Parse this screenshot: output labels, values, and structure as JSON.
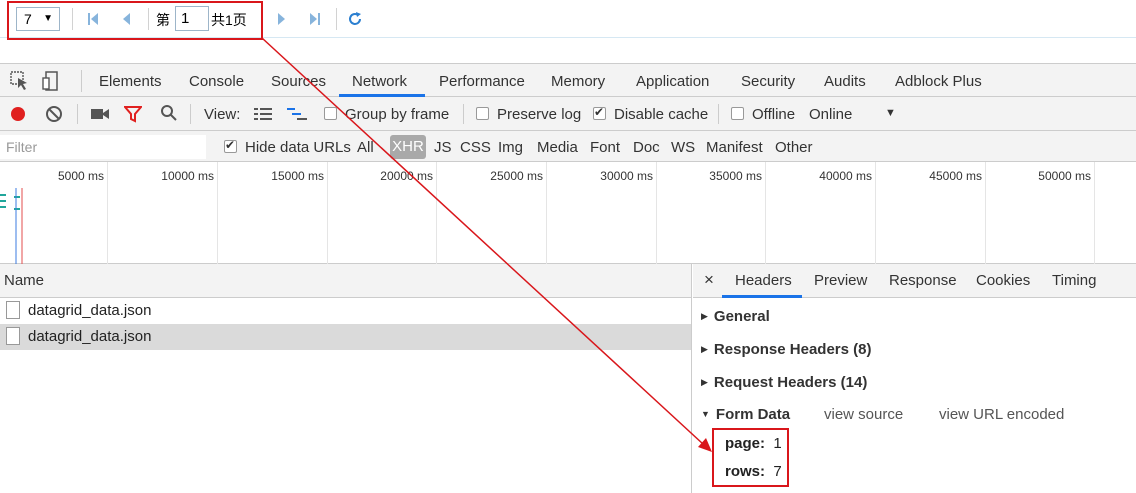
{
  "pager": {
    "page_size": "7",
    "page_prefix": "第",
    "page_value": "1",
    "page_total": "共1页"
  },
  "devtools": {
    "tabs": [
      "Elements",
      "Console",
      "Sources",
      "Network",
      "Performance",
      "Memory",
      "Application",
      "Security",
      "Audits",
      "Adblock Plus"
    ],
    "active_tab": "Network",
    "accent": "#1a73e8",
    "toolbar": {
      "view_label": "View:",
      "group_by_frame": "Group by frame",
      "preserve_log": "Preserve log",
      "disable_cache": "Disable cache",
      "offline": "Offline",
      "throttle": "Online"
    },
    "filter": {
      "placeholder": "Filter",
      "hide_data_urls": "Hide data URLs",
      "types": [
        "All",
        "XHR",
        "JS",
        "CSS",
        "Img",
        "Media",
        "Font",
        "Doc",
        "WS",
        "Manifest",
        "Other"
      ],
      "active_type": "XHR"
    },
    "timeline_ticks": [
      "5000 ms",
      "10000 ms",
      "15000 ms",
      "20000 ms",
      "25000 ms",
      "30000 ms",
      "35000 ms",
      "40000 ms",
      "45000 ms",
      "50000 ms"
    ],
    "requests": {
      "header": "Name",
      "rows": [
        "datagrid_data.json",
        "datagrid_data.json"
      ]
    },
    "details": {
      "close": "×",
      "tabs": [
        "Headers",
        "Preview",
        "Response",
        "Cookies",
        "Timing"
      ],
      "general": "General",
      "response_headers": "Response Headers (8)",
      "request_headers": "Request Headers (14)",
      "form_data": "Form Data",
      "view_source": "view source",
      "view_url_encoded": "view URL encoded",
      "form": [
        {
          "key": "page:",
          "value": "1"
        },
        {
          "key": "rows:",
          "value": "7"
        }
      ]
    }
  },
  "annotation_color": "#d9161b"
}
